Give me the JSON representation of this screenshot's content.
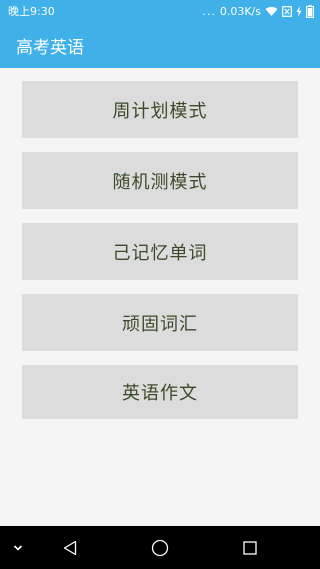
{
  "status_bar": {
    "time": "晚上9:30",
    "dots": "...",
    "network_speed": "0.03K/s"
  },
  "app_bar": {
    "title": "高考英语"
  },
  "menu": {
    "items": [
      {
        "label": "周计划模式"
      },
      {
        "label": "随机测模式"
      },
      {
        "label": "己记忆单词"
      },
      {
        "label": "顽固词汇"
      },
      {
        "label": "英语作文"
      }
    ]
  },
  "colors": {
    "primary": "#3fb1e8",
    "button_bg": "#dcdcdc",
    "button_text": "#3a4a2a",
    "background": "#f5f5f5",
    "nav_bar": "#000000"
  },
  "icons": {
    "status": [
      "wifi-icon",
      "sim-off-icon",
      "charging-icon",
      "battery-icon"
    ],
    "navigation": [
      "collapse-chevron-icon",
      "back-triangle-icon",
      "home-circle-icon",
      "recents-square-icon"
    ]
  }
}
